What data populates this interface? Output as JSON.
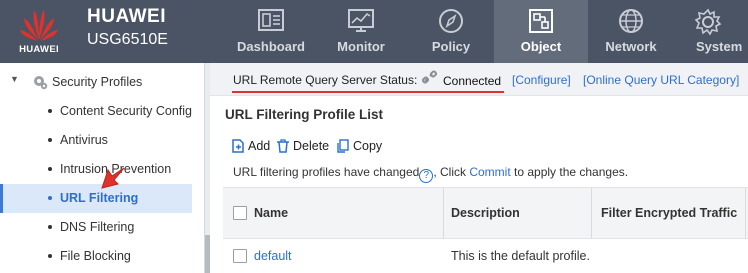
{
  "header": {
    "logo_text": "HUAWEI",
    "brand": "HUAWEI",
    "model": "USG6510E",
    "tabs": [
      {
        "label": "Dashboard",
        "icon": "dashboard-icon"
      },
      {
        "label": "Monitor",
        "icon": "monitor-icon"
      },
      {
        "label": "Policy",
        "icon": "compass-icon"
      },
      {
        "label": "Object",
        "icon": "object-icon",
        "active": true
      },
      {
        "label": "Network",
        "icon": "globe-icon"
      },
      {
        "label": "System",
        "icon": "gear-icon"
      }
    ]
  },
  "sidebar": {
    "parent": {
      "label": "Security Profiles",
      "icon": "gear-icon"
    },
    "items": [
      {
        "label": "Content Security Configu"
      },
      {
        "label": "Antivirus"
      },
      {
        "label": "Intrusion Prevention"
      },
      {
        "label": "URL Filtering",
        "selected": true
      },
      {
        "label": "DNS Filtering"
      },
      {
        "label": "File Blocking"
      }
    ]
  },
  "main": {
    "status": {
      "label": "URL Remote Query Server Status:",
      "value": "Connected",
      "configure_link": "[Configure]",
      "online_link": "[Online Query URL Category]"
    },
    "title": "URL Filtering Profile List",
    "toolbar": {
      "add": "Add",
      "delete": "Delete",
      "copy": "Copy"
    },
    "hint": {
      "before": "URL filtering profiles have changed",
      "middle": ", Click ",
      "commit": "Commit",
      "after": " to apply the changes."
    },
    "table": {
      "columns": [
        "Name",
        "Description",
        "Filter Encrypted Traffic"
      ],
      "rows": [
        {
          "name": "default",
          "description": "This is the default profile."
        }
      ]
    }
  },
  "colors": {
    "header_bg": "#4b5464",
    "active_tab": "#636c7b",
    "accent": "#2c6fd1",
    "selected_bg": "#dbe8f9",
    "red": "#e0312d"
  }
}
